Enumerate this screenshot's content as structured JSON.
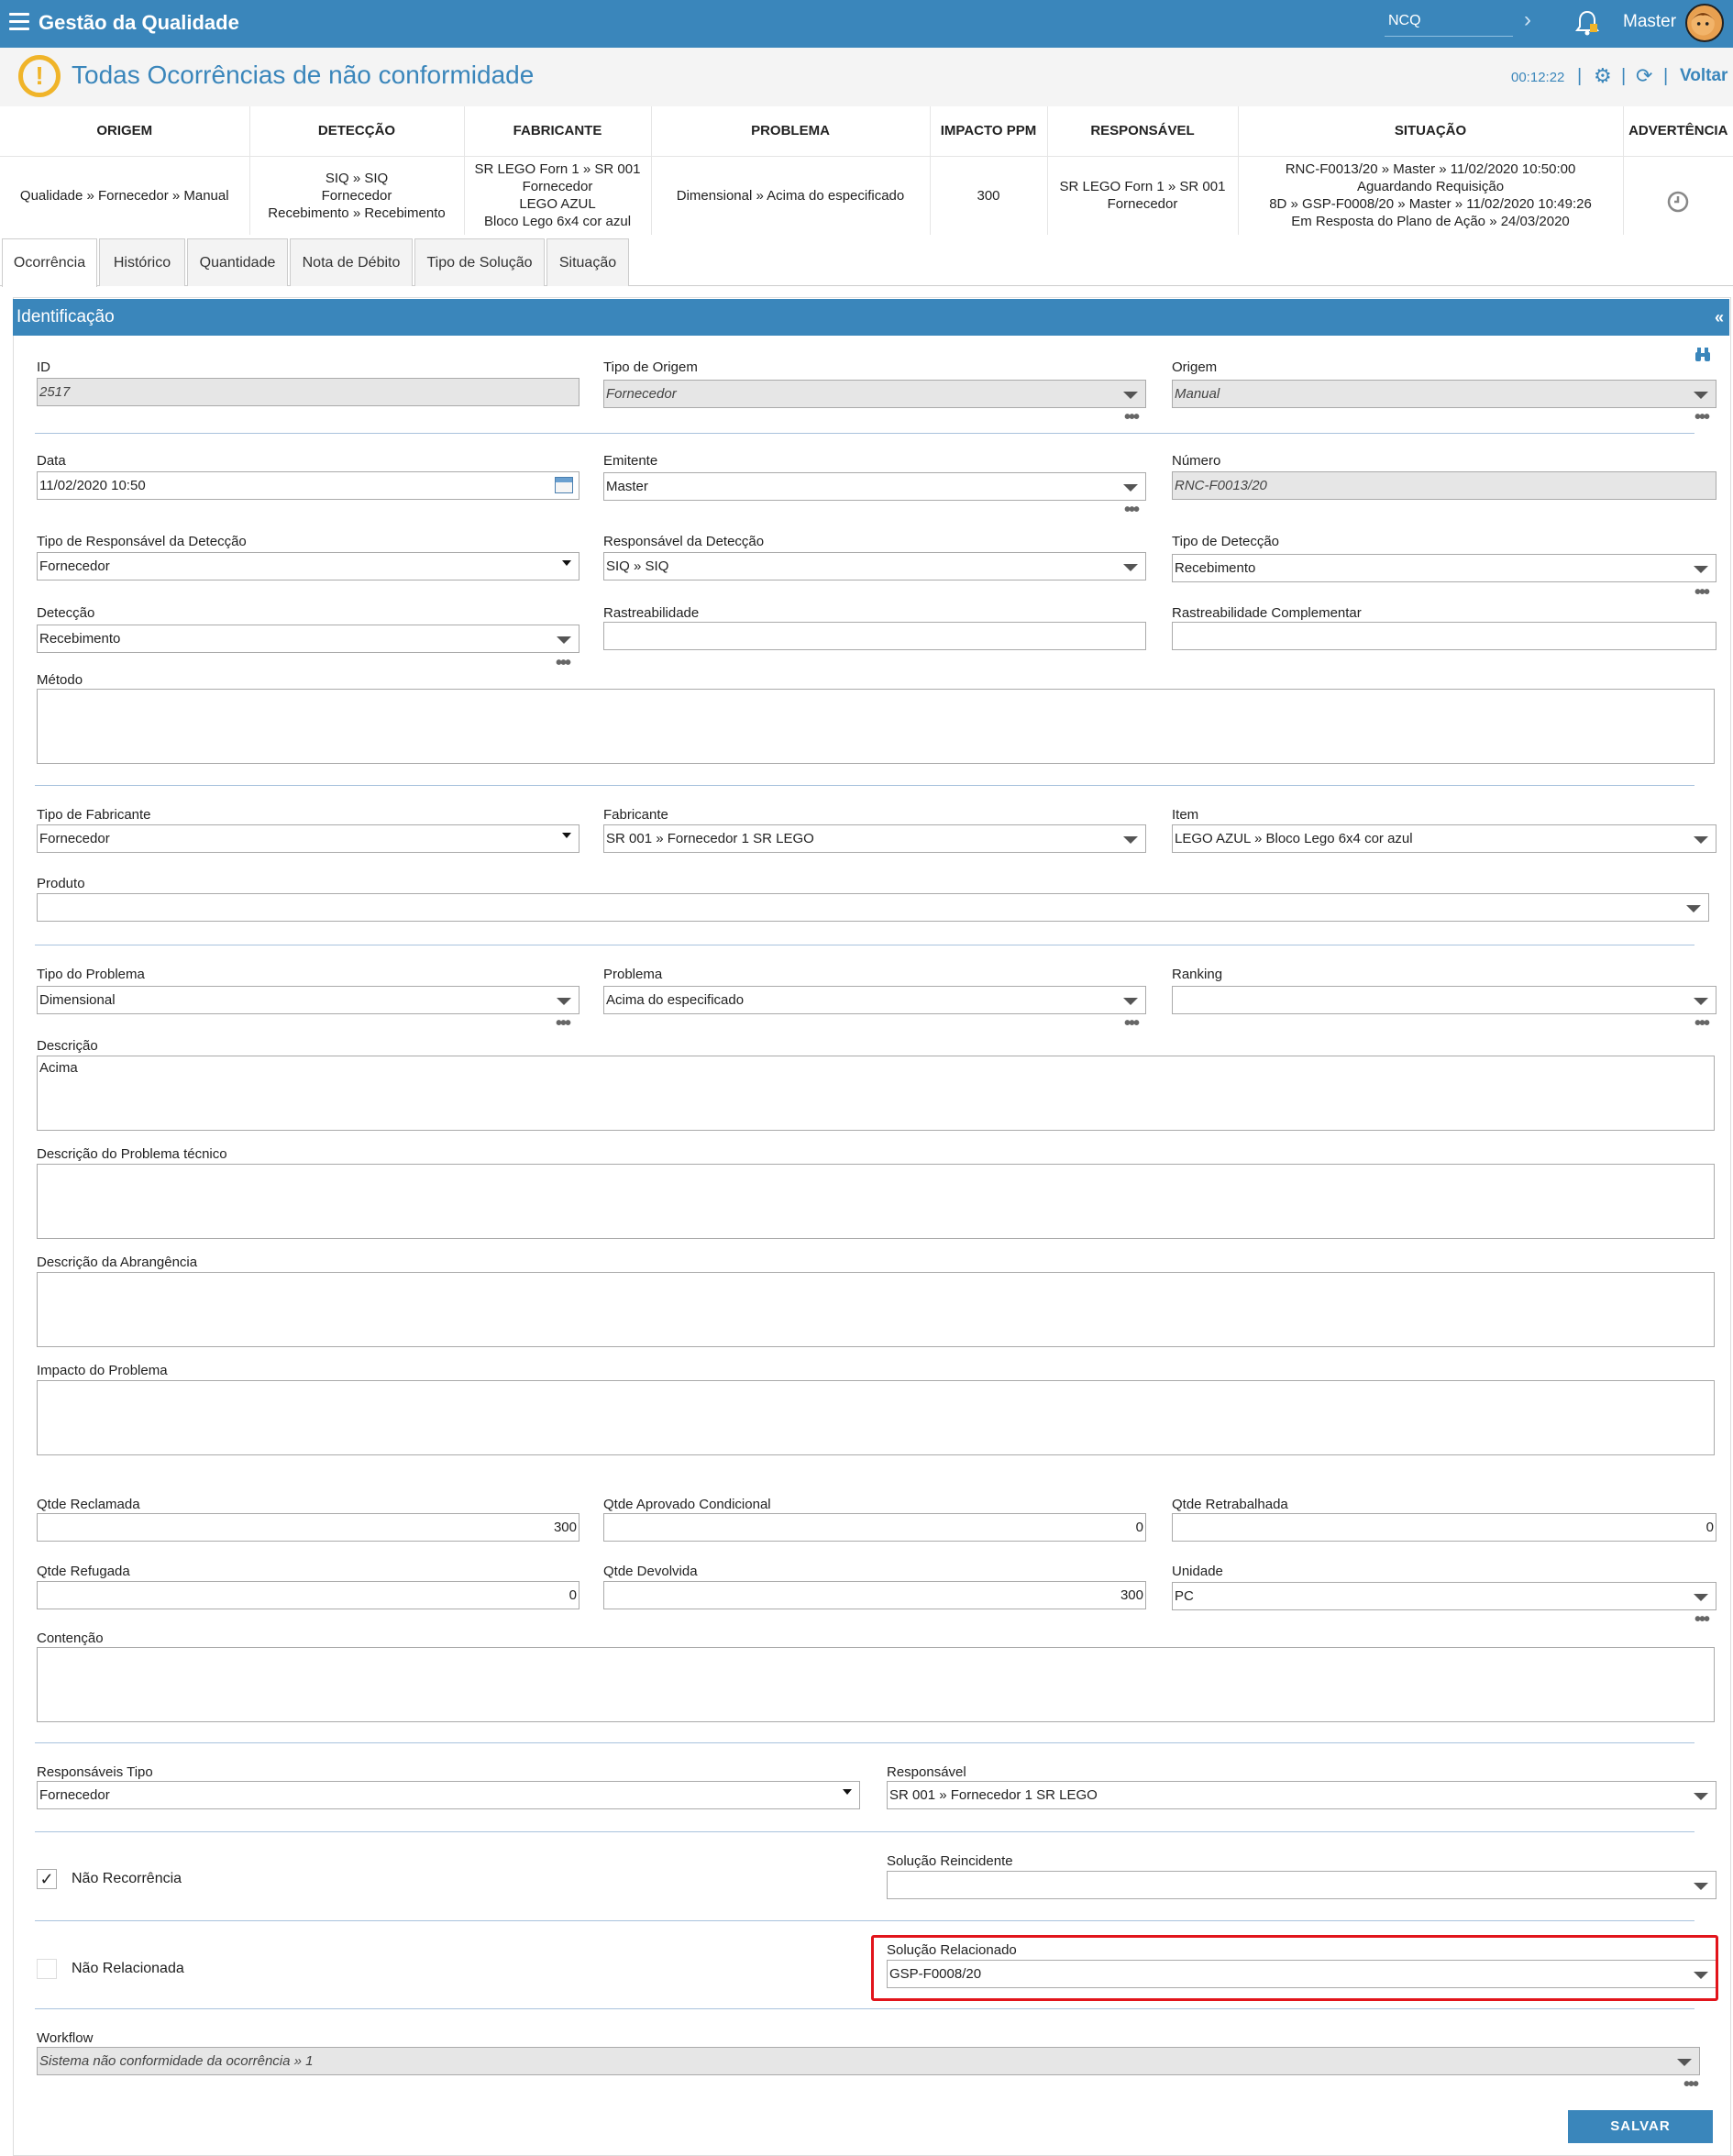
{
  "header": {
    "app_title": "Gestão da Qualidade",
    "module": "NCQ",
    "user": "Master"
  },
  "page": {
    "title": "Todas Ocorrências de não conformidade",
    "timer": "00:12:22",
    "back_label": "Voltar"
  },
  "summary": {
    "headers": [
      "ORIGEM",
      "DETECÇÃO",
      "FABRICANTE",
      "PROBLEMA",
      "IMPACTO PPM",
      "RESPONSÁVEL",
      "SITUAÇÃO",
      "ADVERTÊNCIA"
    ],
    "row": [
      "Qualidade » Fornecedor » Manual",
      "SIQ » SIQ\nFornecedor\nRecebimento » Recebimento",
      "SR LEGO Forn 1 » SR 001\nFornecedor\nLEGO AZUL\nBloco Lego 6x4 cor azul",
      "Dimensional » Acima do especificado",
      "300",
      "SR LEGO Forn 1 » SR 001\nFornecedor",
      "RNC-F0013/20 » Master » 11/02/2020 10:50:00\nAguardando Requisição\n8D » GSP-F0008/20 » Master » 11/02/2020 10:49:26\nEm Resposta do Plano de Ação » 24/03/2020",
      ""
    ]
  },
  "tabs": [
    "Ocorrência",
    "Histórico",
    "Quantidade",
    "Nota de Débito",
    "Tipo de Solução",
    "Situação"
  ],
  "section": {
    "title": "Identificação",
    "collapse": "«"
  },
  "form": {
    "id_label": "ID",
    "id_value": "2517",
    "tipo_origem_label": "Tipo de Origem",
    "tipo_origem_value": "Fornecedor",
    "origem_label": "Origem",
    "origem_value": "Manual",
    "data_label": "Data",
    "data_value": "11/02/2020 10:50",
    "emitente_label": "Emitente",
    "emitente_value": "Master",
    "numero_label": "Número",
    "numero_value": "RNC-F0013/20",
    "tipo_resp_det_label": "Tipo de Responsável da Detecção",
    "tipo_resp_det_value": "Fornecedor",
    "resp_det_label": "Responsável da Detecção",
    "resp_det_value": "SIQ » SIQ",
    "tipo_det_label": "Tipo de Detecção",
    "tipo_det_value": "Recebimento",
    "deteccao_label": "Detecção",
    "deteccao_value": "Recebimento",
    "rastreab_label": "Rastreabilidade",
    "rastreab_value": "",
    "rastreab_comp_label": "Rastreabilidade Complementar",
    "rastreab_comp_value": "",
    "metodo_label": "Método",
    "metodo_value": "",
    "tipo_fab_label": "Tipo de Fabricante",
    "tipo_fab_value": "Fornecedor",
    "fabricante_label": "Fabricante",
    "fabricante_value": "SR 001 » Fornecedor 1 SR LEGO",
    "item_label": "Item",
    "item_value": "LEGO AZUL » Bloco Lego 6x4 cor azul",
    "produto_label": "Produto",
    "produto_value": "",
    "tipo_prob_label": "Tipo do Problema",
    "tipo_prob_value": "Dimensional",
    "problema_label": "Problema",
    "problema_value": "Acima do especificado",
    "ranking_label": "Ranking",
    "ranking_value": "",
    "descricao_label": "Descrição",
    "descricao_value": "Acima",
    "desc_tec_label": "Descrição do Problema técnico",
    "desc_tec_value": "",
    "desc_abr_label": "Descrição da Abrangência",
    "desc_abr_value": "",
    "impacto_label": "Impacto do Problema",
    "impacto_value": "",
    "qtde_recl_label": "Qtde Reclamada",
    "qtde_recl_value": "300",
    "qtde_aprov_label": "Qtde Aprovado Condicional",
    "qtde_aprov_value": "0",
    "qtde_retr_label": "Qtde Retrabalhada",
    "qtde_retr_value": "0",
    "qtde_ref_label": "Qtde Refugada",
    "qtde_ref_value": "0",
    "qtde_dev_label": "Qtde Devolvida",
    "qtde_dev_value": "300",
    "unidade_label": "Unidade",
    "unidade_value": "PC",
    "contencao_label": "Contenção",
    "contencao_value": "",
    "resp_tipo_label": "Responsáveis Tipo",
    "resp_tipo_value": "Fornecedor",
    "responsavel_label": "Responsável",
    "responsavel_value": "SR 001 » Fornecedor 1 SR LEGO",
    "nao_recorr_label": "Não Recorrência",
    "nao_recorr_check": "✓",
    "sol_reinc_label": "Solução Reincidente",
    "sol_reinc_value": "",
    "nao_relac_label": "Não Relacionada",
    "sol_relac_label": "Solução Relacionado",
    "sol_relac_value": "GSP-F0008/20",
    "workflow_label": "Workflow",
    "workflow_value": "Sistema não conformidade da ocorrência » 1",
    "save_label": "SALVAR"
  },
  "colors": {
    "primary": "#3a86bb",
    "highlight": "#e2141b",
    "warning": "#f0b429"
  }
}
